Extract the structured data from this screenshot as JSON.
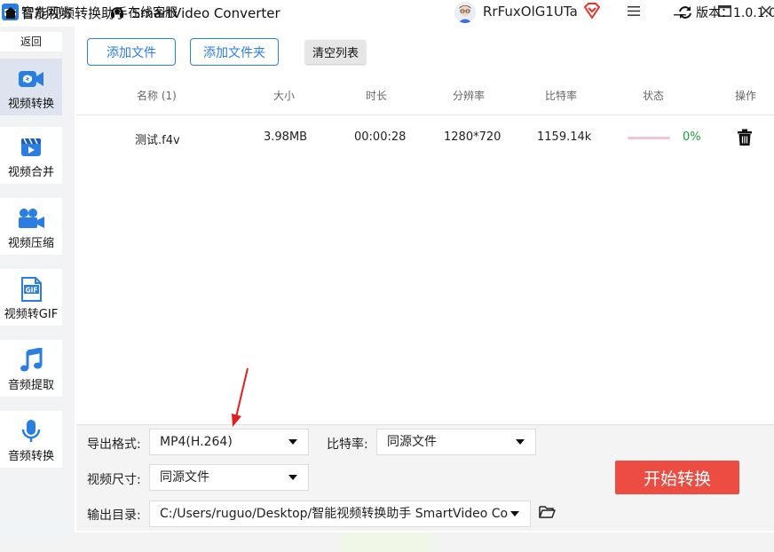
{
  "titlebar": {
    "title": "智能视频转换助手 SmartVideo Converter",
    "username": "RrFuxOlG1UTa",
    "menu_icon": "hamburger-icon",
    "minimize_icon": "minimize-icon",
    "maximize_icon": "maximize-icon",
    "close_icon": "close-icon"
  },
  "sidebar": {
    "back_label": "返回",
    "items": [
      {
        "label": "视频转换",
        "icon": "video-convert-icon",
        "active": true
      },
      {
        "label": "视频合并",
        "icon": "video-merge-icon",
        "active": false
      },
      {
        "label": "视频压缩",
        "icon": "video-compress-icon",
        "active": false
      },
      {
        "label": "视频转GIF",
        "icon": "gif-icon",
        "active": false
      },
      {
        "label": "音频提取",
        "icon": "music-note-icon",
        "active": false
      },
      {
        "label": "音频转换",
        "icon": "microphone-icon",
        "active": false
      }
    ]
  },
  "toolbar": {
    "add_file": "添加文件",
    "add_folder": "添加文件夹",
    "clear_list": "清空列表"
  },
  "table": {
    "headers": {
      "name": "名称 (1)",
      "size": "大小",
      "duration": "时长",
      "resolution": "分辨率",
      "bitrate": "比特率",
      "status": "状态",
      "action": "操作"
    },
    "rows": [
      {
        "name": "测试.f4v",
        "size": "3.98MB",
        "duration": "00:00:28",
        "resolution": "1280*720",
        "bitrate": "1159.14k",
        "progress_text": "0%",
        "progress": 0
      }
    ]
  },
  "settings": {
    "format_label": "导出格式:",
    "format_value": "MP4(H.264)",
    "bitrate_label": "比特率:",
    "bitrate_value": "同源文件",
    "size_label": "视频尺寸:",
    "size_value": "同源文件",
    "output_label": "输出目录:",
    "output_value": "C:/Users/ruguo/Desktop/智能视频转换助手 SmartVideo Co",
    "start_button": "开始转换"
  },
  "statusbar": {
    "website": "官方网站",
    "support": "在线客服",
    "version": "版本：1.0.1.0"
  },
  "colors": {
    "accent": "#2a7de1",
    "start": "#ec4c41",
    "progress": "#1e9c3a",
    "annotation_arrow": "#e02020"
  }
}
